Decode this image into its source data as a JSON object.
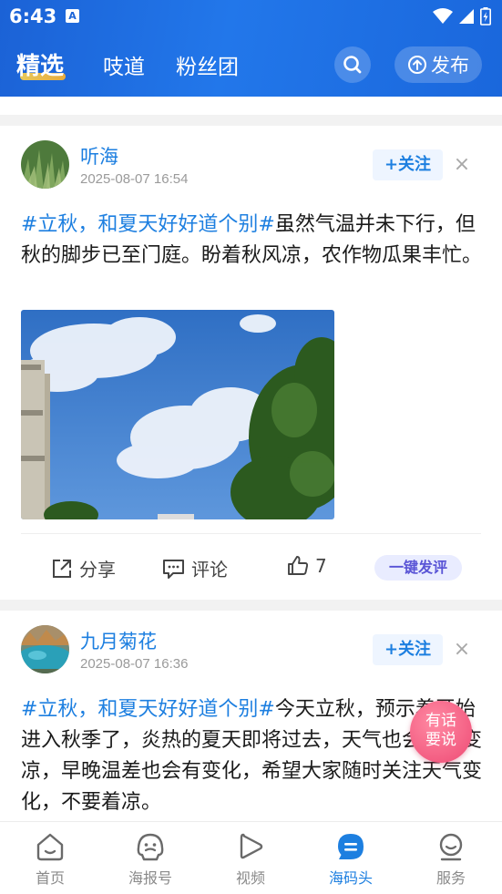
{
  "status_bar": {
    "time": "6:43",
    "notification_glyph": "A"
  },
  "top_nav": {
    "tabs": [
      {
        "label": "精选",
        "active": true
      },
      {
        "label": "吱道",
        "active": false
      },
      {
        "label": "粉丝团",
        "active": false
      }
    ],
    "publish_label": "发布"
  },
  "posts": [
    {
      "username": "听海",
      "time": "2025-08-07 16:54",
      "follow_label": "+关注",
      "tag": "#立秋，和夏天好好道个别#",
      "text": "虽然气温并未下行，但秋的脚步已至门庭。盼着秋风凉，农作物瓜果丰忙。",
      "share_label": "分享",
      "comment_label": "评论",
      "like_count": "7",
      "quick_comment_label": "一键发评"
    },
    {
      "username": "九月菊花",
      "time": "2025-08-07 16:36",
      "follow_label": "+关注",
      "tag": "#立秋，和夏天好好道个别#",
      "text": "今天立秋，预示着开始进入秋季了，炎热的夏天即将过去，天气也会慢慢变凉，早晚温差也会有变化，希望大家随时关注天气变化，不要着凉。"
    }
  ],
  "float_button": {
    "line1": "有话",
    "line2": "要说"
  },
  "bottom_nav": [
    {
      "label": "首页",
      "icon": "home-icon",
      "active": false
    },
    {
      "label": "海报号",
      "icon": "poster-icon",
      "active": false
    },
    {
      "label": "视频",
      "icon": "video-play-icon",
      "active": false
    },
    {
      "label": "海码头",
      "icon": "chat-bubble-icon",
      "active": true
    },
    {
      "label": "服务",
      "icon": "service-icon",
      "active": false
    }
  ],
  "colors": {
    "header_blue": "#1c66dc",
    "accent": "#1d7fe0",
    "bubble_pink": "#ee4a74"
  }
}
